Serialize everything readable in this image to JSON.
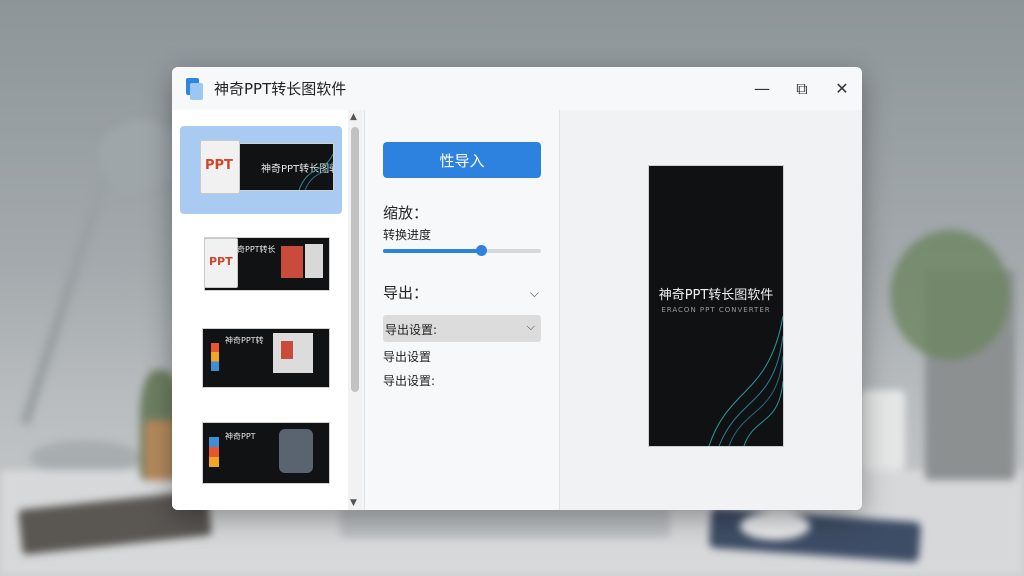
{
  "window": {
    "title": "神奇PPT转长图软件",
    "controls": {
      "minimize": "—",
      "restore": "⧉",
      "close": "✕"
    }
  },
  "thumbnails": {
    "selected_index": 0,
    "items": [
      {
        "doc_label": "PPT",
        "slide_text": "神奇PPT转长图软件"
      },
      {
        "doc_label": "PPT",
        "slide_text": "神奇PPT转长"
      },
      {
        "doc_label": "",
        "slide_text": "神奇PPT转"
      },
      {
        "doc_label": "",
        "slide_text": "神奇PPT"
      }
    ]
  },
  "controls": {
    "import_button": "性导入",
    "zoom_label": "缩放：",
    "zoom_sub_label": "转换进度",
    "slider_value": 0.62,
    "export_label": "导出：",
    "dropdown_label": "导出设置:",
    "option_1": "导出设置",
    "option_2": "导出设置:"
  },
  "preview": {
    "title": "神奇PPT转长图软件",
    "subtitle": "ERACON PPT CONVERTER"
  },
  "colors": {
    "accent": "#2d82e0",
    "selection": "#a9cbf2"
  }
}
